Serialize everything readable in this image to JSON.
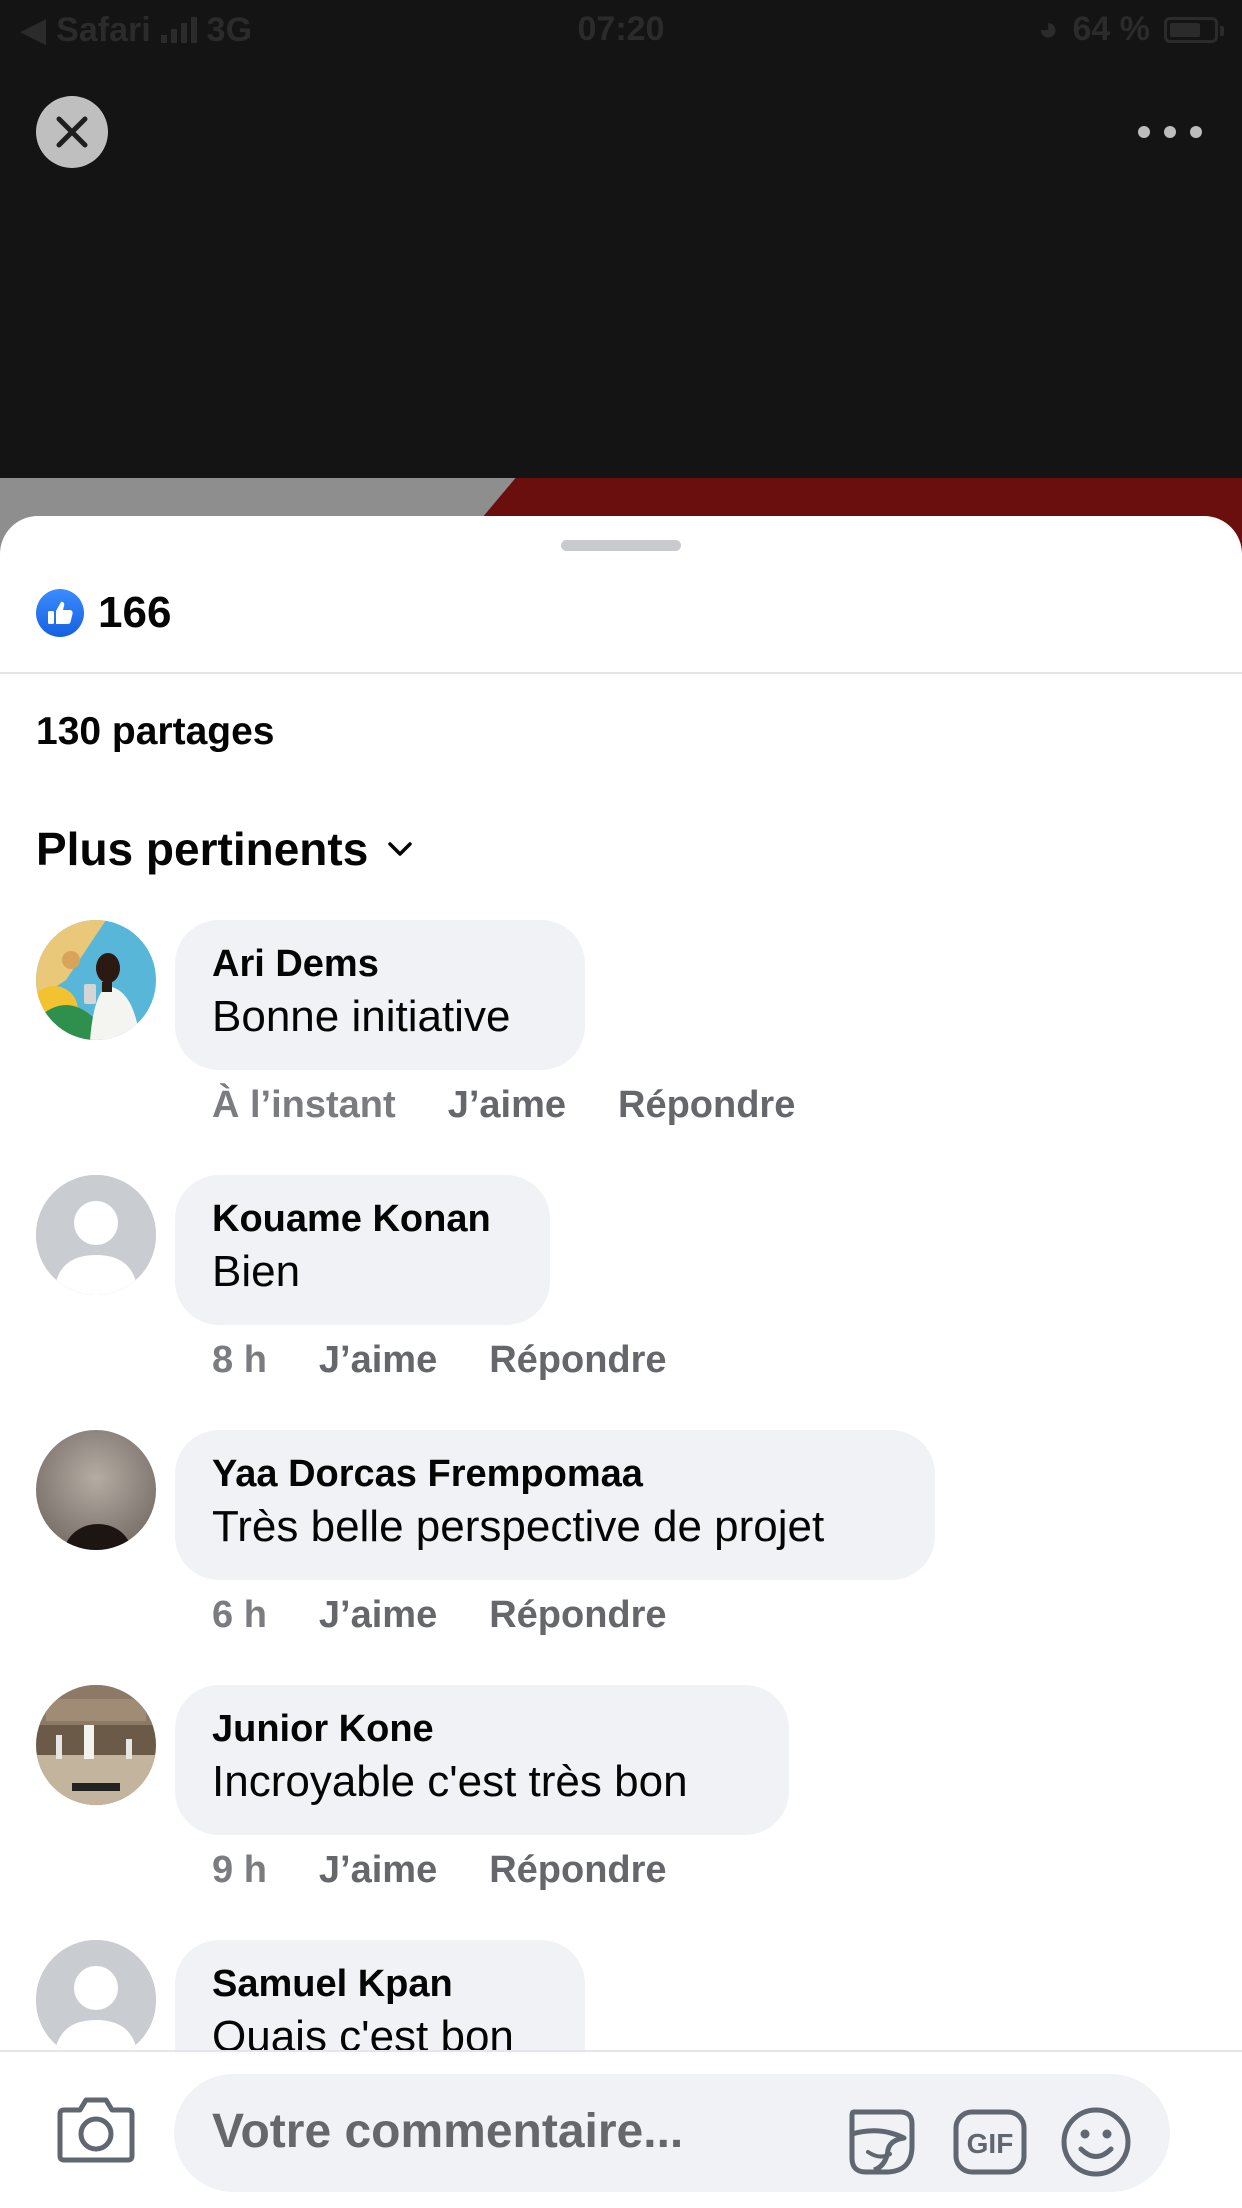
{
  "status_bar": {
    "back_app": "Safari",
    "network": "3G",
    "time": "07:20",
    "battery": "64 %"
  },
  "post": {
    "like_count": "166",
    "shares": "130 partages",
    "sort_label": "Plus pertinents"
  },
  "comments": [
    {
      "name": "Ari Dems",
      "text": "Bonne initiative",
      "time": "À l’instant",
      "like": "J’aime",
      "reply": "Répondre"
    },
    {
      "name": "Kouame Konan",
      "text": "Bien",
      "time": "8 h",
      "like": "J’aime",
      "reply": "Répondre"
    },
    {
      "name": "Yaa Dorcas Frempomaa",
      "text": "Très belle perspective de projet",
      "time": "6 h",
      "like": "J’aime",
      "reply": "Répondre"
    },
    {
      "name": "Junior Kone",
      "text": "Incroyable c'est très bon",
      "time": "9 h",
      "like": "J’aime",
      "reply": "Répondre"
    },
    {
      "name": "Samuel Kpan",
      "text": "Ouais c'est bon"
    }
  ],
  "composer": {
    "placeholder": "Votre commentaire...",
    "gif_label": "GIF"
  },
  "colors": {
    "like_blue": "#1877f2",
    "bubble_bg": "#f0f2f5",
    "meta_grey": "#65676b"
  }
}
